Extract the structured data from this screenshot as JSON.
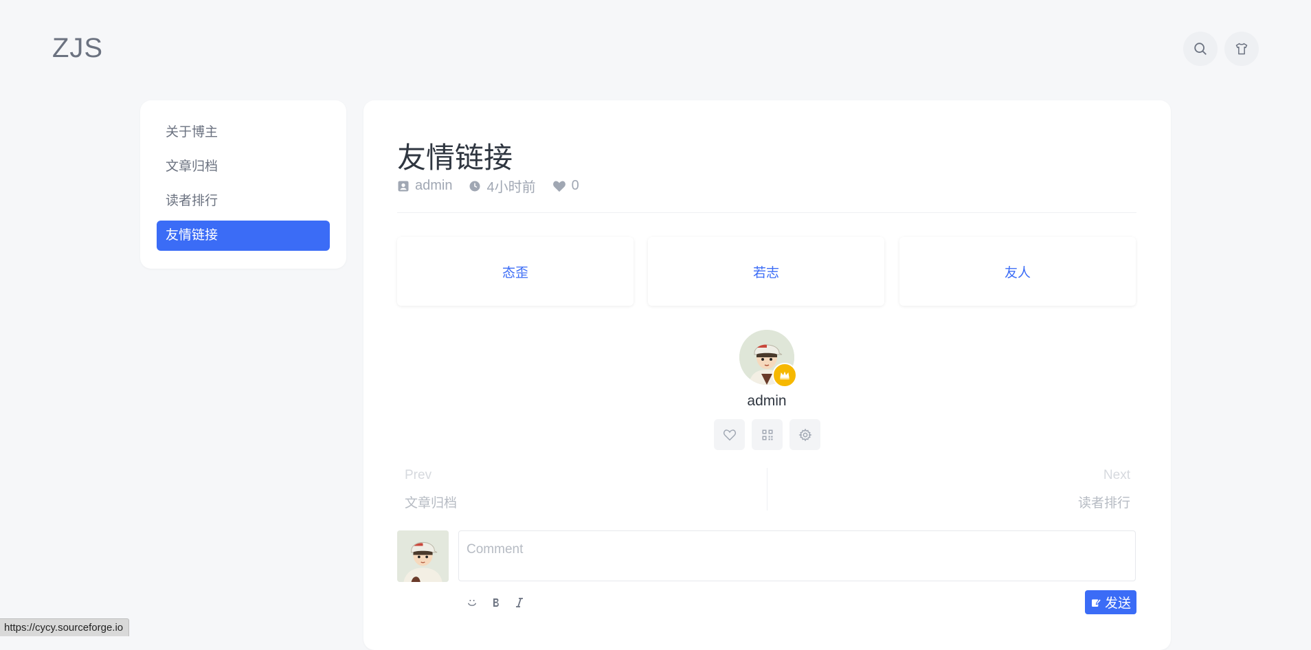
{
  "header": {
    "logo": "ZJS",
    "search_icon": "search-icon",
    "theme_icon": "tshirt-icon"
  },
  "sidebar": {
    "items": [
      {
        "label": "关于博主"
      },
      {
        "label": "文章归档"
      },
      {
        "label": "读者排行"
      },
      {
        "label": "友情链接",
        "active": true
      }
    ]
  },
  "post": {
    "title": "友情链接",
    "author": "admin",
    "time": "4小时前",
    "likes": "0"
  },
  "links": [
    {
      "name": "态歪"
    },
    {
      "name": "若志"
    },
    {
      "name": "友人"
    }
  ],
  "author_card": {
    "name": "admin",
    "badge": "crown-icon",
    "actions": [
      "heart-icon",
      "qrcode-icon",
      "gear-icon"
    ]
  },
  "navigation": {
    "prev_label": "Prev",
    "prev_title": "文章归档",
    "next_label": "Next",
    "next_title": "读者排行"
  },
  "comment": {
    "placeholder": "Comment",
    "tools": [
      "smile-icon",
      "bold-icon",
      "italic-icon"
    ],
    "send_label": "发送"
  },
  "status_bar": {
    "url": "https://cycy.sourceforge.io"
  },
  "colors": {
    "accent": "#3b6cf6",
    "badge": "#f6b800",
    "background": "#f6f7f9"
  }
}
